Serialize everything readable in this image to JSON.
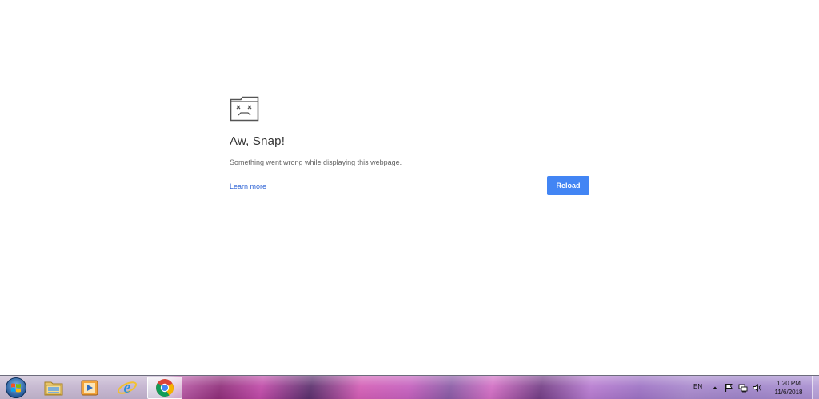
{
  "error_page": {
    "icon": "sad-tab-icon",
    "title": "Aw, Snap!",
    "message": "Something went wrong while displaying this webpage.",
    "learn_more_label": "Learn more",
    "reload_label": "Reload",
    "accent_color": "#4285f4",
    "link_color": "#3367d6"
  },
  "taskbar": {
    "start_icon": "windows-start-icon",
    "pinned": [
      {
        "name": "file-explorer-icon"
      },
      {
        "name": "media-player-icon"
      },
      {
        "name": "internet-explorer-icon"
      },
      {
        "name": "chrome-icon",
        "active": true
      }
    ],
    "tray": {
      "language": "EN",
      "icons": [
        "show-hidden-icons-chevron",
        "action-center-flag-icon",
        "network-icon",
        "volume-icon"
      ],
      "time": "1:20 PM",
      "date": "11/6/2018"
    }
  }
}
